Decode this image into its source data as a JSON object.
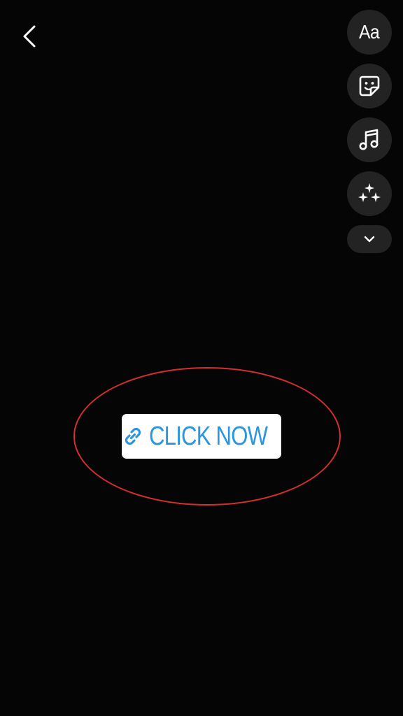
{
  "colors": {
    "background": "#050505",
    "tool_button_bg": "#232323",
    "icon": "#ffffff",
    "sticker_bg": "#ffffff",
    "sticker_text": "#2b96dd",
    "annotation": "#d3302d"
  },
  "toolbar": {
    "back_icon": "chevron-left-icon",
    "tools": [
      {
        "name": "text-tool",
        "label": "Aa"
      },
      {
        "name": "sticker-tool",
        "icon": "sticker-icon"
      },
      {
        "name": "music-tool",
        "icon": "music-note-icon"
      },
      {
        "name": "effects-tool",
        "icon": "sparkles-icon"
      }
    ],
    "more_icon": "chevron-down-icon"
  },
  "link_sticker": {
    "icon": "link-icon",
    "label": "CLICK NOW"
  }
}
